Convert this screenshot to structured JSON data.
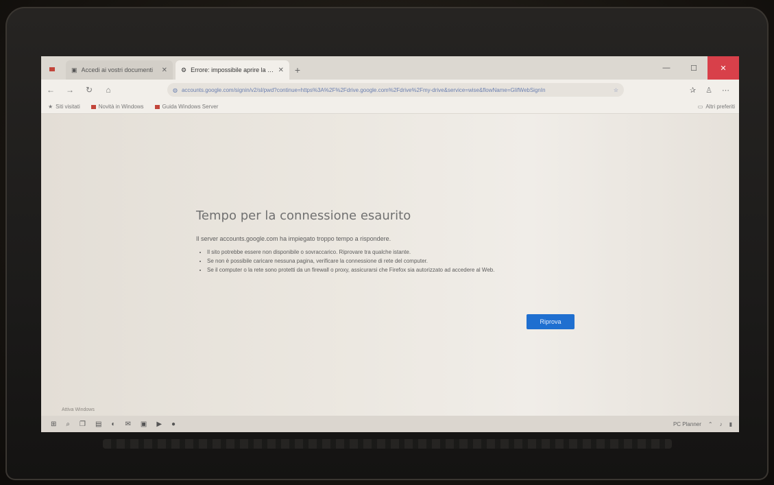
{
  "browser": {
    "tabs": [
      {
        "label": "Accedi ai vostri documenti",
        "active": false
      },
      {
        "label": "Errore: impossibile aprire la pagina",
        "active": true
      }
    ],
    "new_tab": "+",
    "window_controls": {
      "minimize": "—",
      "maximize": "☐",
      "close": "✕"
    },
    "address": {
      "url": "accounts.google.com/signin/v2/sl/pwd?continue=https%3A%2F%2Fdrive.google.com%2Fdrive%2Fmy-drive&service=wise&flowName=GlifWebSignIn"
    },
    "bookmarks": [
      {
        "label": "Siti visitati"
      },
      {
        "label": "Novità in Windows"
      },
      {
        "label": "Guida Windows Server"
      }
    ],
    "bookmarks_right": "Altri preferiti"
  },
  "error": {
    "title": "Tempo per la connessione esaurito",
    "description": "Il server accounts.google.com ha impiegato troppo tempo a rispondere.",
    "tips": [
      "Il sito potrebbe essere non disponibile o sovraccarico. Riprovare tra qualche istante.",
      "Se non è possibile caricare nessuna pagina, verificare la connessione di rete del computer.",
      "Se il computer o la rete sono protetti da un firewall o proxy, assicurarsi che Firefox sia autorizzato ad accedere al Web."
    ],
    "retry_label": "Riprova"
  },
  "taskbar": {
    "tray_text": "PC Planner",
    "activate_text": "Attiva Windows"
  },
  "colors": {
    "accent": "#1f6fd0",
    "close": "#d8404a"
  }
}
